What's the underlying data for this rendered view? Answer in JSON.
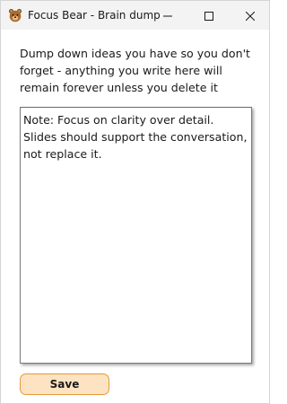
{
  "window": {
    "title": "Focus Bear - Brain dump",
    "app_icon": "bear-face-icon",
    "controls": {
      "minimize_icon": "minimize-icon",
      "maximize_icon": "maximize-icon",
      "close_icon": "close-icon"
    }
  },
  "main": {
    "instructions": "Dump down ideas you have so you don't forget - anything you write here will remain forever unless you delete it",
    "note_value": "Note: Focus on clarity over detail. Slides should support the conversation, not replace it.",
    "save_label": "Save"
  },
  "colors": {
    "save_bg": "#fde3c2",
    "save_border": "#e49a3b",
    "titlebar_bg": "#f3f3f3"
  }
}
